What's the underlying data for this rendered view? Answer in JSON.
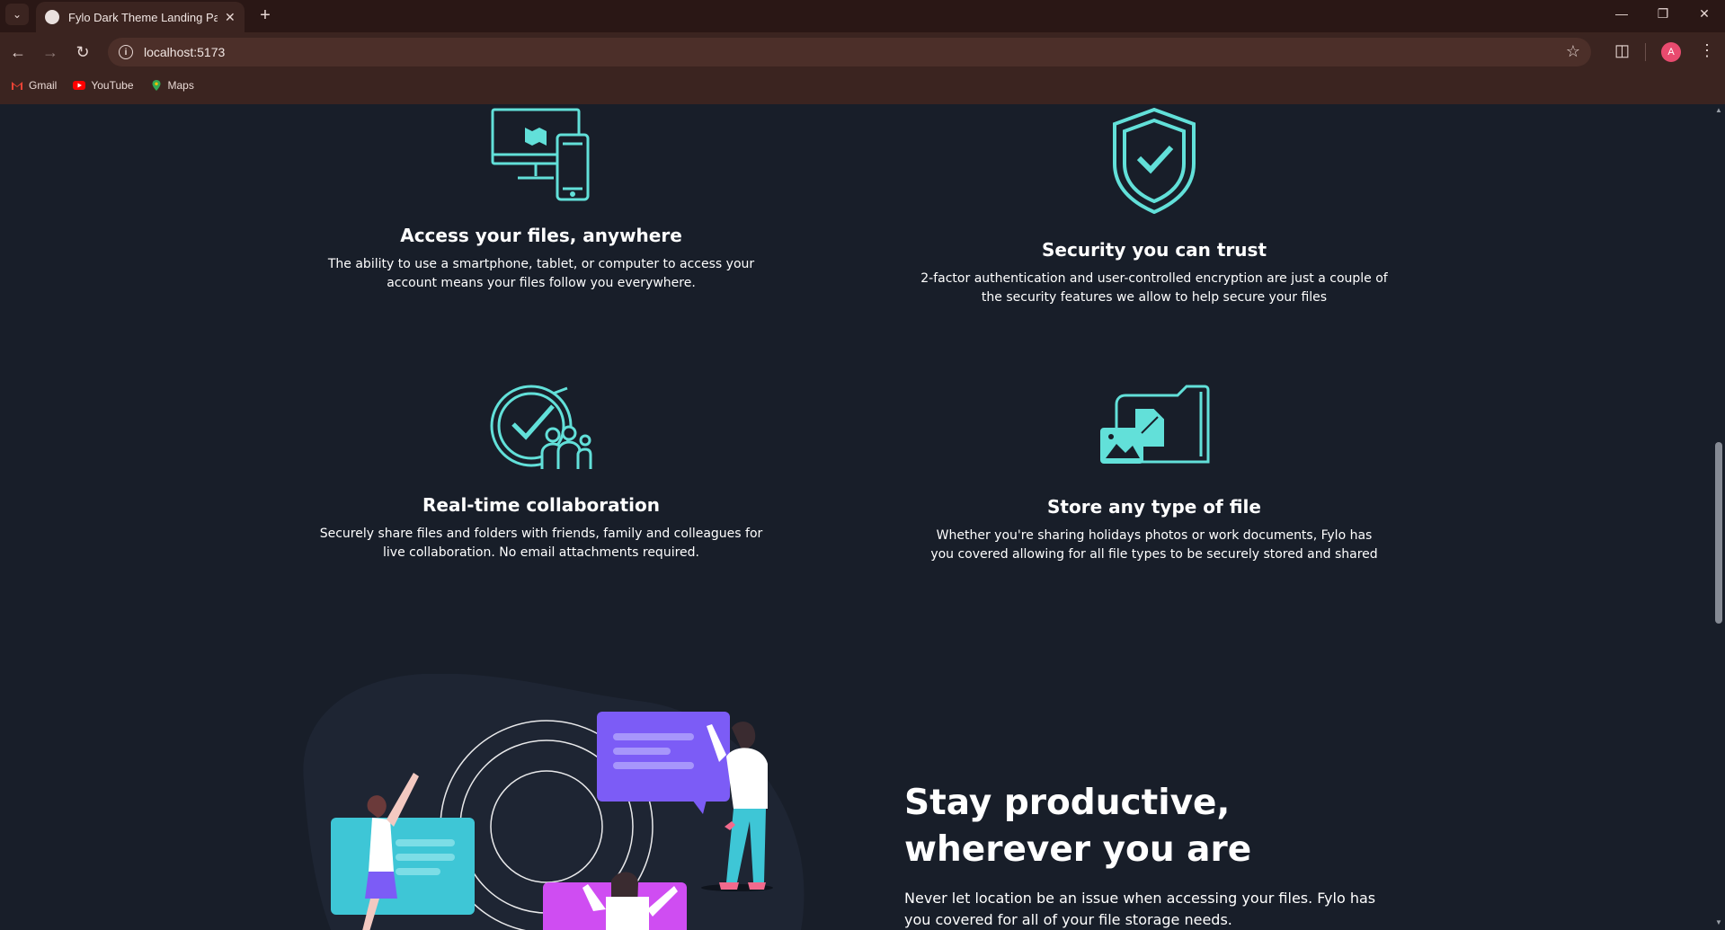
{
  "browser": {
    "tab_title": "Fylo Dark Theme Landing Page",
    "url": "localhost:5173",
    "profile_initial": "A",
    "bookmarks": [
      {
        "label": "Gmail",
        "icon": "gmail-icon"
      },
      {
        "label": "YouTube",
        "icon": "youtube-icon"
      },
      {
        "label": "Maps",
        "icon": "maps-icon"
      }
    ]
  },
  "features": [
    {
      "title": "Access your files, anywhere",
      "text": "The ability to use a smartphone, tablet, or computer to access your account means your files follow you everywhere.",
      "icon": "devices-icon"
    },
    {
      "title": "Security you can trust",
      "text": "2-factor authentication and user-controlled encryption are just a couple of the security features we allow to help secure your files",
      "icon": "shield-check-icon"
    },
    {
      "title": "Real-time collaboration",
      "text": "Securely share files and folders with friends, family and colleagues for live collaboration. No email attachments required.",
      "icon": "collaboration-icon"
    },
    {
      "title": "Store any type of file",
      "text": "Whether you're sharing holidays photos or work documents, Fylo has you covered allowing for all file types to be securely stored and shared",
      "icon": "folder-files-icon"
    }
  ],
  "productive": {
    "title_line1": "Stay productive,",
    "title_line2": "wherever you are",
    "text": "Never let location be an issue when accessing your files. Fylo has you covered for all of your file storage needs."
  },
  "colors": {
    "page_bg": "#181e29",
    "accent_teal": "#62e0d9",
    "chrome_bg": "#3b2420"
  }
}
